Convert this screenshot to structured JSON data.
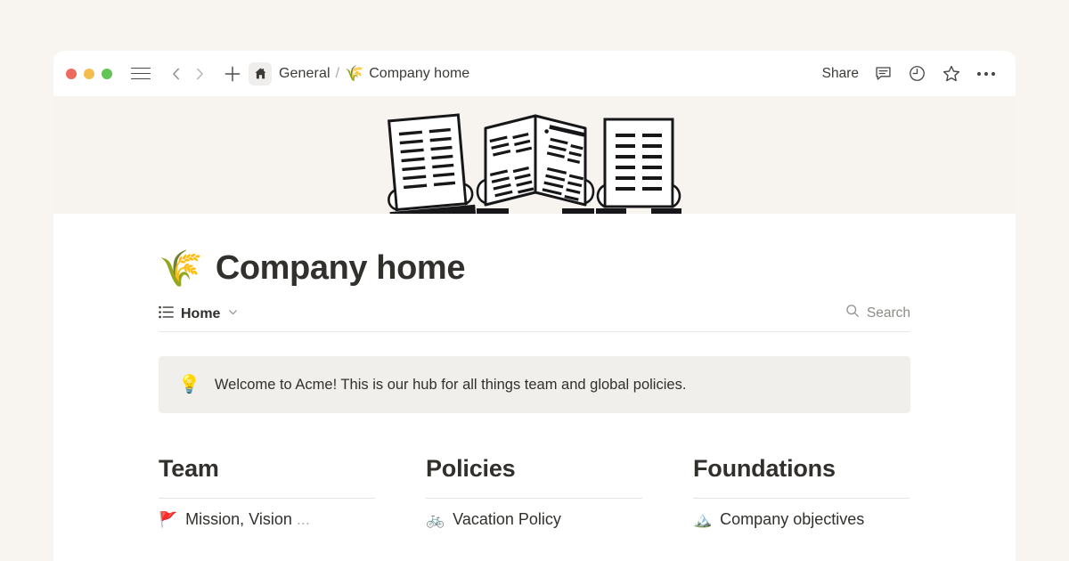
{
  "window": {
    "toolbar": {
      "traffic_lights": [
        {
          "name": "close",
          "color": "#EC6A5E"
        },
        {
          "name": "minimize",
          "color": "#F4BD4F"
        },
        {
          "name": "zoom",
          "color": "#61C454"
        }
      ],
      "menu_icon": "hamburger-menu-icon",
      "back_icon": "chevron-left-icon",
      "forward_icon": "chevron-right-icon",
      "new_icon": "plus-icon",
      "home_icon": "home-icon",
      "breadcrumb": {
        "parent": "General",
        "separator": "/",
        "current_emoji": "🌾",
        "current": "Company home"
      },
      "share_label": "Share",
      "comment_icon": "comment-bubble-icon",
      "history_icon": "clock-icon",
      "favorite_icon": "star-icon",
      "more_icon": "ellipsis-icon"
    },
    "cover": {
      "alt": "black and white illustration of three pairs of hands holding open newspapers"
    },
    "page": {
      "title_emoji": "🌾",
      "title": "Company home",
      "tab": {
        "icon": "list-icon",
        "label": "Home",
        "chevron": "chevron-down-icon"
      },
      "search": {
        "icon": "search-icon",
        "label": "Search"
      },
      "callout": {
        "emoji": "💡",
        "text": "Welcome to Acme! This is our hub for all things team and global policies."
      },
      "columns": [
        {
          "heading": "Team",
          "items": [
            {
              "emoji": "🚩",
              "label": "Mission, Vision",
              "suffix": "..."
            }
          ]
        },
        {
          "heading": "Policies",
          "items": [
            {
              "emoji": "🚲",
              "label": "Vacation Policy",
              "suffix": ""
            }
          ]
        },
        {
          "heading": "Foundations",
          "items": [
            {
              "emoji": "🏔️",
              "label": "Company objectives",
              "suffix": ""
            }
          ]
        }
      ]
    }
  },
  "colors": {
    "page_background": "#F8F5F0",
    "window_background": "#FFFFFF",
    "cover_background": "#F7F4EF",
    "callout_background": "#F0EFEC",
    "text_primary": "#32302C",
    "text_muted": "#8D8B86"
  }
}
